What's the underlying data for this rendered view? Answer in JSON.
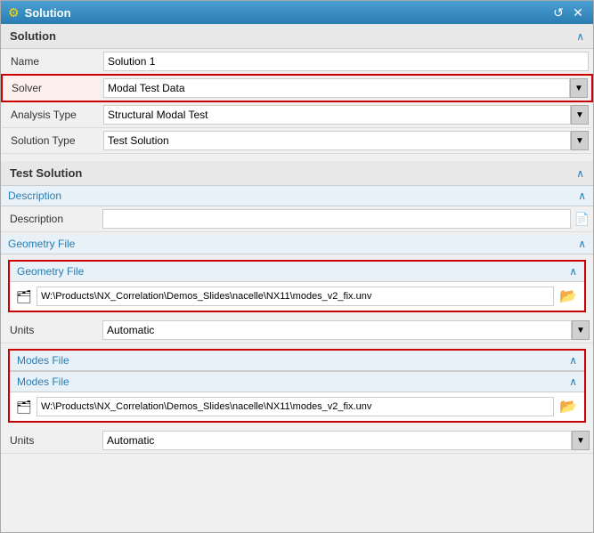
{
  "window": {
    "title": "Solution",
    "icon": "⚙",
    "restore_button": "↺",
    "close_button": "✕"
  },
  "solution_section": {
    "title": "Solution",
    "chevron": "∧"
  },
  "form_fields": {
    "name_label": "Name",
    "name_value": "Solution 1",
    "solver_label": "Solver",
    "solver_value": "Modal Test Data",
    "analysis_type_label": "Analysis Type",
    "analysis_type_value": "Structural Modal Test",
    "solution_type_label": "Solution Type",
    "solution_type_value": "Test Solution"
  },
  "test_solution_section": {
    "title": "Test Solution",
    "chevron": "∧"
  },
  "description_subsection": {
    "title": "Description",
    "chevron": "∧"
  },
  "description_row": {
    "label": "Description",
    "value": "",
    "doc_icon": "📄"
  },
  "geometry_file_section": {
    "title": "Geometry File",
    "chevron": "∧"
  },
  "geometry_file_subsection": {
    "title": "Geometry File",
    "chevron": "∧",
    "file_path": "W:\\Products\\NX_Correlation\\Demos_Slides\\nacelle\\NX11\\modes_v2_fix.unv",
    "file_icon": "🗂",
    "folder_icon": "📂"
  },
  "geometry_units_row": {
    "label": "Units",
    "value": "Automatic"
  },
  "modes_file_section": {
    "title": "Modes File",
    "chevron": "∧"
  },
  "modes_file_subsection": {
    "title": "Modes File",
    "chevron": "∧",
    "file_path": "W:\\Products\\NX_Correlation\\Demos_Slides\\nacelle\\NX11\\modes_v2_fix.unv",
    "file_icon": "🗂",
    "folder_icon": "📂"
  },
  "modes_units_row": {
    "label": "Units",
    "value": "Automatic"
  }
}
